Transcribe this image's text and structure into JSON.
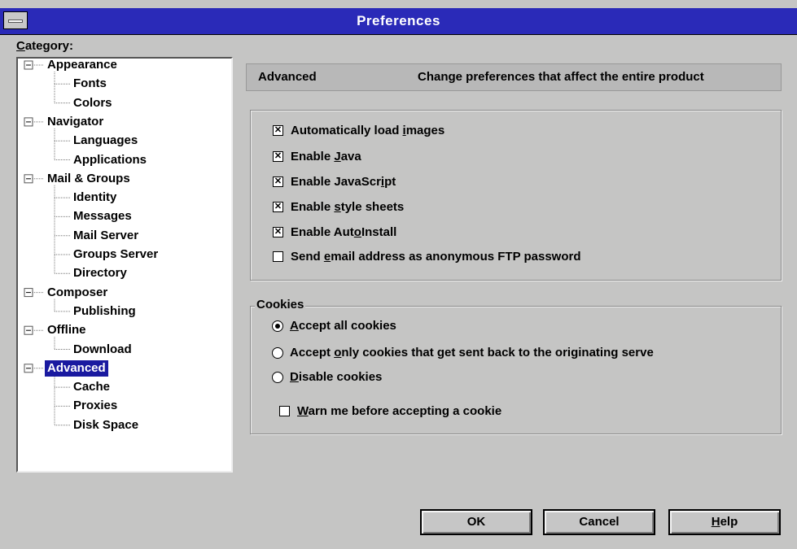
{
  "window": {
    "title": "Preferences"
  },
  "category": {
    "label_prefix": "C",
    "label_rest": "ategory:"
  },
  "tree": [
    {
      "label": "Appearance",
      "level": 1
    },
    {
      "label": "Fonts",
      "level": 2
    },
    {
      "label": "Colors",
      "level": 2
    },
    {
      "label": "Navigator",
      "level": 1
    },
    {
      "label": "Languages",
      "level": 2
    },
    {
      "label": "Applications",
      "level": 2
    },
    {
      "label": "Mail & Groups",
      "level": 1
    },
    {
      "label": "Identity",
      "level": 2
    },
    {
      "label": "Messages",
      "level": 2
    },
    {
      "label": "Mail Server",
      "level": 2
    },
    {
      "label": "Groups Server",
      "level": 2
    },
    {
      "label": "Directory",
      "level": 2
    },
    {
      "label": "Composer",
      "level": 1
    },
    {
      "label": "Publishing",
      "level": 2
    },
    {
      "label": "Offline",
      "level": 1
    },
    {
      "label": "Download",
      "level": 2
    },
    {
      "label": "Advanced",
      "level": 1,
      "selected": true
    },
    {
      "label": "Cache",
      "level": 2
    },
    {
      "label": "Proxies",
      "level": 2
    },
    {
      "label": "Disk Space",
      "level": 2
    }
  ],
  "header": {
    "section": "Advanced",
    "description": "Change preferences that affect the entire product"
  },
  "options": {
    "auto_load_images": {
      "pre": "Automatically load ",
      "key": "i",
      "post": "mages",
      "checked": true
    },
    "enable_java": {
      "pre": "Enable ",
      "key": "J",
      "post": "ava",
      "checked": true
    },
    "enable_javascript": {
      "pre": "Enable JavaScr",
      "key": "i",
      "post": "pt",
      "checked": true
    },
    "enable_style_sheets": {
      "pre": "Enable ",
      "key": "s",
      "post": "tyle sheets",
      "checked": true
    },
    "enable_autoinstall": {
      "pre": "Enable Aut",
      "key": "o",
      "post": "Install",
      "checked": true
    },
    "send_email_ftp": {
      "pre": "Send ",
      "key": "e",
      "post": "mail address as anonymous FTP password",
      "checked": false
    }
  },
  "cookies": {
    "group_label": "Cookies",
    "accept_all": {
      "pre": "",
      "key": "A",
      "post": "ccept all cookies",
      "selected": true
    },
    "accept_only": {
      "pre": "Accept ",
      "key": "o",
      "post": "nly cookies that get sent back to the originating serve",
      "selected": false
    },
    "disable": {
      "pre": "",
      "key": "D",
      "post": "isable cookies",
      "selected": false
    },
    "warn": {
      "pre": "",
      "key": "W",
      "post": "arn me before accepting a cookie",
      "checked": false
    }
  },
  "buttons": {
    "ok": "OK",
    "cancel": "Cancel",
    "help_key": "H",
    "help_rest": "elp"
  },
  "check_mark": "✕"
}
